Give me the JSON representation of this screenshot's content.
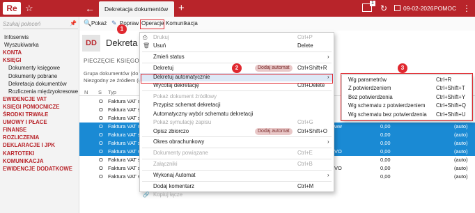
{
  "app": {
    "logo": "Re",
    "tab_title": "Dekretacja dokumentów",
    "notif_count": "1",
    "date": "09-02-2026",
    "help": "POMOC"
  },
  "sidebar": {
    "search_placeholder": "Szukaj poleceń",
    "items": [
      {
        "label": "Infoserwis",
        "kind": "plain"
      },
      {
        "label": "Wyszukiwarka",
        "kind": "plain"
      },
      {
        "label": "KONTA",
        "kind": "cat"
      },
      {
        "label": "KSIĘGI",
        "kind": "cat"
      },
      {
        "label": "Dokumenty księgowe",
        "kind": "sub"
      },
      {
        "label": "Dokumenty pobrane",
        "kind": "sub"
      },
      {
        "label": "Dekretacja dokumentów",
        "kind": "sub"
      },
      {
        "label": "Rozliczenia międzyokresowe",
        "kind": "sub"
      },
      {
        "label": "EWIDENCJE VAT",
        "kind": "cat"
      },
      {
        "label": "KSIĘGI POMOCNICZE",
        "kind": "cat"
      },
      {
        "label": "ŚRODKI TRWAŁE",
        "kind": "cat"
      },
      {
        "label": "UMOWY I PŁACE",
        "kind": "cat"
      },
      {
        "label": "FINANSE",
        "kind": "cat"
      },
      {
        "label": "ROZLICZENIA",
        "kind": "cat"
      },
      {
        "label": "DEKLARACJE I JPK",
        "kind": "cat"
      },
      {
        "label": "KARTOTEKI",
        "kind": "cat"
      },
      {
        "label": "KOMUNIKACJA",
        "kind": "cat"
      },
      {
        "label": "EWIDENCJE DODATKOWE",
        "kind": "cat"
      }
    ]
  },
  "toolbar": {
    "show": "Pokaż",
    "edit": "Popraw",
    "operations": "Operacje",
    "communication": "Komunikacja"
  },
  "header": {
    "code": "DD",
    "title": "Dekreta",
    "section": "PIECZĘCIE KSIĘGOWE",
    "filter1": "Grupa dokumentów (do",
    "filter2": "Niezgodny ze źródłem (d"
  },
  "table": {
    "columns": [
      "N",
      "S",
      "Typ"
    ],
    "rows": [
      {
        "s": "O",
        "typ": "Faktura VAT sp",
        "tail": "",
        "val": "0,00",
        "auto": "(auto)",
        "sel": false
      },
      {
        "s": "O",
        "typ": "Faktura VAT sp",
        "tail": "",
        "val": "0,00",
        "auto": "(auto)",
        "sel": false
      },
      {
        "s": "O",
        "typ": "Faktura VAT sp",
        "tail": "",
        "val": "0,00",
        "auto": "(auto)",
        "sel": false
      },
      {
        "s": "O",
        "typ": "Faktura VAT sp",
        "tail": "ww",
        "val": "0,00",
        "auto": "(auto)",
        "sel": true
      },
      {
        "s": "O",
        "typ": "Faktura VAT sp",
        "tail": "",
        "val": "0,00",
        "auto": "(auto)",
        "sel": true
      },
      {
        "s": "O",
        "typ": "Faktura VAT sp",
        "tail": "",
        "val": "0,00",
        "auto": "(auto)",
        "sel": true
      },
      {
        "s": "O",
        "typ": "Faktura VAT sp",
        "tail": "VO",
        "val": "0,00",
        "auto": "(auto)",
        "sel": true
      },
      {
        "s": "O",
        "typ": "Faktura VAT sp",
        "tail": "",
        "val": "0,00",
        "auto": "(auto)",
        "sel": false
      },
      {
        "s": "O",
        "typ": "Faktura VAT sp",
        "tail": "VO",
        "val": "0,00",
        "auto": "(auto)",
        "sel": false
      },
      {
        "s": "O",
        "typ": "Faktura VAT sp",
        "tail": "",
        "val": "0,00",
        "auto": "(auto)",
        "sel": false
      }
    ]
  },
  "menu": {
    "items": [
      {
        "label": "Drukuj",
        "shortcut": "Ctrl+P",
        "disabled": true,
        "icon": "printer-icon"
      },
      {
        "label": "Usuń",
        "shortcut": "Delete",
        "disabled": false,
        "icon": "trash-icon"
      },
      {
        "sep": true
      },
      {
        "label": "Zmień status",
        "arrow": true
      },
      {
        "sep": true
      },
      {
        "label": "Dekretuj",
        "shortcut": "Ctrl+Shift+R",
        "badge": "Dodaj automat"
      },
      {
        "label": "Dekretuj automatycznie",
        "arrow": true,
        "highlight": true
      },
      {
        "label": "Wycofaj dekretację",
        "shortcut": "Ctrl+Delete"
      },
      {
        "sep": true
      },
      {
        "label": "Pokaż dokument źródłowy",
        "disabled": true
      },
      {
        "label": "Przypisz schemat dekretacji"
      },
      {
        "label": "Automatyczny wybór schematu dekretacji"
      },
      {
        "label": "Pokaż symulację zapisu",
        "shortcut": "Ctrl+G",
        "disabled": true
      },
      {
        "label": "Opisz zbiorczo",
        "shortcut": "Ctrl+Shift+O",
        "badge": "Dodaj automat"
      },
      {
        "sep": true
      },
      {
        "label": "Okres obrachunkowy",
        "arrow": true
      },
      {
        "sep": true
      },
      {
        "label": "Dokumenty powiązane",
        "shortcut": "Ctrl+E",
        "disabled": true
      },
      {
        "sep": true
      },
      {
        "label": "Załączniki",
        "shortcut": "Ctrl+B",
        "disabled": true
      },
      {
        "sep": true
      },
      {
        "label": "Wykonaj Automat",
        "arrow": true
      },
      {
        "sep": true
      },
      {
        "label": "Dodaj komentarz",
        "shortcut": "Ctrl+M"
      },
      {
        "label": "Kopiuj łącze",
        "disabled": true,
        "icon": "link-icon"
      }
    ]
  },
  "submenu": {
    "items": [
      {
        "label": "Wg parametrów",
        "shortcut": "Ctrl+R"
      },
      {
        "label": "Z potwierdzeniem",
        "shortcut": "Ctrl+Shift+T"
      },
      {
        "label": "Bez potwierdzenia",
        "shortcut": "Ctrl+Shift+Y"
      },
      {
        "label": "Wg schematu z potwierdzeniem",
        "shortcut": "Ctrl+Shift+Q"
      },
      {
        "label": "Wg schematu bez potwierdzenia",
        "shortcut": "Ctrl+Shift+U"
      }
    ]
  },
  "callouts": [
    "1",
    "2",
    "3"
  ],
  "colors": {
    "brand": "#b8242a",
    "selection": "#1a8ad4",
    "annotation": "#e0282f"
  }
}
